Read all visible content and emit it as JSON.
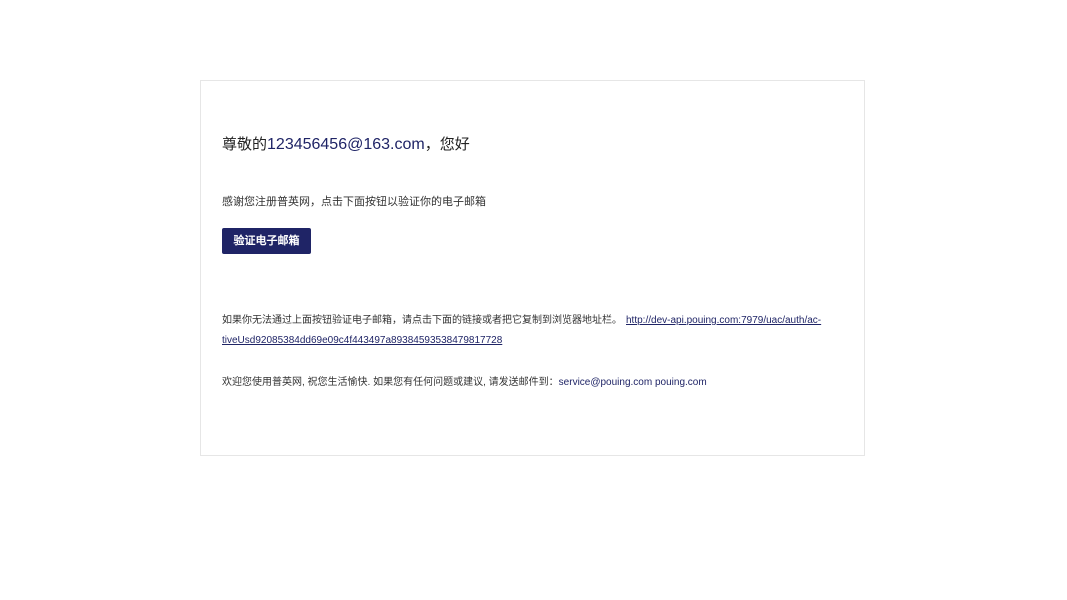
{
  "greeting": {
    "prefix": "尊敬的",
    "email": "123456456@163.com",
    "suffix": "，您好"
  },
  "intro_text": "感谢您注册普英网，点击下面按钮以验证你的电子邮箱",
  "verify_button_label": "验证电子邮箱",
  "fallback": {
    "text": "如果你无法通过上面按钮验证电子邮箱，请点击下面的链接或者把它复制到浏览器地址栏。",
    "link": "http://dev-api.pouing.com:7979/uac/auth/ac-tiveUsd92085384dd69e09c4f443497a89384593538479817728"
  },
  "footer": {
    "text": "欢迎您使用普英网, 祝您生活愉快. 如果您有任何问题或建议, 请发送邮件到：",
    "contact": "service@pouing.com pouing.com"
  },
  "colors": {
    "accent": "#1f2466",
    "border": "#e6e6e6"
  }
}
